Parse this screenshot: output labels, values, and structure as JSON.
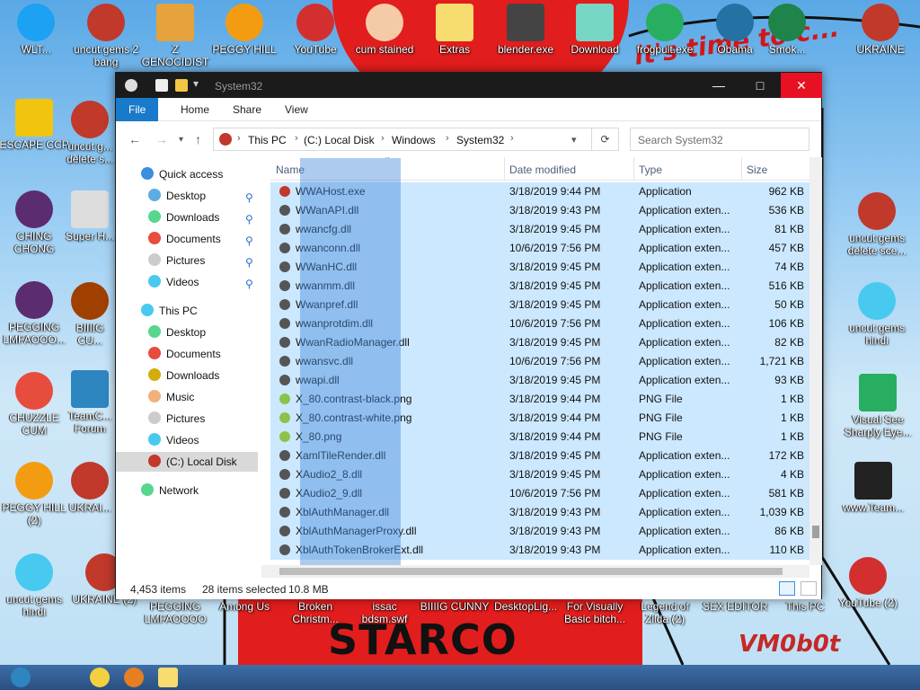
{
  "desktop": {
    "icons_left": [
      {
        "label": "WLT..."
      },
      {
        "label": "uncut gems 2 bang"
      },
      {
        "label": "Z GENOCIDIST"
      },
      {
        "label": "PEGGY HILL"
      },
      {
        "label": "YouTube"
      },
      {
        "label": "cum stained"
      },
      {
        "label": "Extras"
      },
      {
        "label": "blender.exe"
      },
      {
        "label": "Download"
      },
      {
        "label": "frogpult.exe"
      },
      {
        "label": "Obama"
      },
      {
        "label": "Smok..."
      },
      {
        "label": "UKRAINE"
      }
    ],
    "icons_col1": [
      {
        "label": "ESCAPE CCP"
      },
      {
        "label": "CHING CHONG"
      },
      {
        "label": "PEGGING LMFAOOO..."
      },
      {
        "label": "CHUZZLE CUM"
      },
      {
        "label": "PEGGY HILL (2)"
      },
      {
        "label": "uncut gems hindi"
      }
    ],
    "icons_col2": [
      {
        "label": "uncut g... delete s..."
      },
      {
        "label": "Super H..."
      },
      {
        "label": "BIIIIG CU..."
      },
      {
        "label": "TeamC... Forum"
      },
      {
        "label": "UKRAI..."
      },
      {
        "label": "UKRAINE (2)"
      }
    ],
    "icons_right": [
      {
        "label": "uncut gems delete sce..."
      },
      {
        "label": "uncut gems hindi"
      },
      {
        "label": "Visual See Sharply Eye..."
      },
      {
        "label": "www.Team..."
      },
      {
        "label": "YouTube (2)"
      }
    ],
    "icons_bottom": [
      {
        "label": "PEGGING LMFAOOOO"
      },
      {
        "label": "Among Us"
      },
      {
        "label": "Broken Christm..."
      },
      {
        "label": "issac bdsm.swf"
      },
      {
        "label": "BIIIIG CUNNY"
      },
      {
        "label": "DesktopLig..."
      },
      {
        "label": "For Visually Basic bitch..."
      },
      {
        "label": "Legend of Zilda (2)"
      },
      {
        "label": "SEX EDITOR"
      },
      {
        "label": "This PC"
      }
    ],
    "wallpaper_text": {
      "center": "STARCO",
      "right": "VM0b0t",
      "top": "it's time to c..."
    }
  },
  "window": {
    "title": "System32",
    "ribbon_tabs": [
      "File",
      "Home",
      "Share",
      "View"
    ],
    "address": {
      "crumbs": [
        "This PC",
        "(C:) Local Disk",
        "Windows",
        "System32"
      ]
    },
    "search_placeholder": "Search System32",
    "nav": {
      "quick_access": "Quick access",
      "quick_items": [
        "Desktop",
        "Downloads",
        "Documents",
        "Pictures",
        "Videos"
      ],
      "this_pc": "This PC",
      "pc_items": [
        "Desktop",
        "Documents",
        "Downloads",
        "Music",
        "Pictures",
        "Videos",
        "(C:) Local Disk"
      ],
      "network": "Network"
    },
    "columns": {
      "name": "Name",
      "date": "Date modified",
      "type": "Type",
      "size": "Size"
    },
    "files": [
      {
        "name": "WWAHost.exe",
        "date": "3/18/2019 9:44 PM",
        "type": "Application",
        "size": "962 KB"
      },
      {
        "name": "WWanAPI.dll",
        "date": "3/18/2019 9:43 PM",
        "type": "Application exten...",
        "size": "536 KB"
      },
      {
        "name": "wwancfg.dll",
        "date": "3/18/2019 9:45 PM",
        "type": "Application exten...",
        "size": "81 KB"
      },
      {
        "name": "wwanconn.dll",
        "date": "10/6/2019 7:56 PM",
        "type": "Application exten...",
        "size": "457 KB"
      },
      {
        "name": "WWanHC.dll",
        "date": "3/18/2019 9:45 PM",
        "type": "Application exten...",
        "size": "74 KB"
      },
      {
        "name": "wwanmm.dll",
        "date": "3/18/2019 9:45 PM",
        "type": "Application exten...",
        "size": "516 KB"
      },
      {
        "name": "Wwanpref.dll",
        "date": "3/18/2019 9:45 PM",
        "type": "Application exten...",
        "size": "50 KB"
      },
      {
        "name": "wwanprotdim.dll",
        "date": "10/6/2019 7:56 PM",
        "type": "Application exten...",
        "size": "106 KB"
      },
      {
        "name": "WwanRadioManager.dll",
        "date": "3/18/2019 9:45 PM",
        "type": "Application exten...",
        "size": "82 KB"
      },
      {
        "name": "wwansvc.dll",
        "date": "10/6/2019 7:56 PM",
        "type": "Application exten...",
        "size": "1,721 KB"
      },
      {
        "name": "wwapi.dll",
        "date": "3/18/2019 9:45 PM",
        "type": "Application exten...",
        "size": "93 KB"
      },
      {
        "name": "X_80.contrast-black.png",
        "date": "3/18/2019 9:44 PM",
        "type": "PNG File",
        "size": "1 KB"
      },
      {
        "name": "X_80.contrast-white.png",
        "date": "3/18/2019 9:44 PM",
        "type": "PNG File",
        "size": "1 KB"
      },
      {
        "name": "X_80.png",
        "date": "3/18/2019 9:44 PM",
        "type": "PNG File",
        "size": "1 KB"
      },
      {
        "name": "XamlTileRender.dll",
        "date": "3/18/2019 9:45 PM",
        "type": "Application exten...",
        "size": "172 KB"
      },
      {
        "name": "XAudio2_8.dll",
        "date": "3/18/2019 9:45 PM",
        "type": "Application exten...",
        "size": "4 KB"
      },
      {
        "name": "XAudio2_9.dll",
        "date": "10/6/2019 7:56 PM",
        "type": "Application exten...",
        "size": "581 KB"
      },
      {
        "name": "XblAuthManager.dll",
        "date": "3/18/2019 9:43 PM",
        "type": "Application exten...",
        "size": "1,039 KB"
      },
      {
        "name": "XblAuthManagerProxy.dll",
        "date": "3/18/2019 9:43 PM",
        "type": "Application exten...",
        "size": "86 KB"
      },
      {
        "name": "XblAuthTokenBrokerExt.dll",
        "date": "3/18/2019 9:43 PM",
        "type": "Application exten...",
        "size": "110 KB"
      }
    ],
    "status": {
      "count": "4,453 items",
      "selected": "28 items selected",
      "size": "10.8 MB"
    }
  },
  "colors": {
    "accent": "#1979ca",
    "selection": "#cce8ff",
    "titlebar": "#1b1b1b"
  }
}
